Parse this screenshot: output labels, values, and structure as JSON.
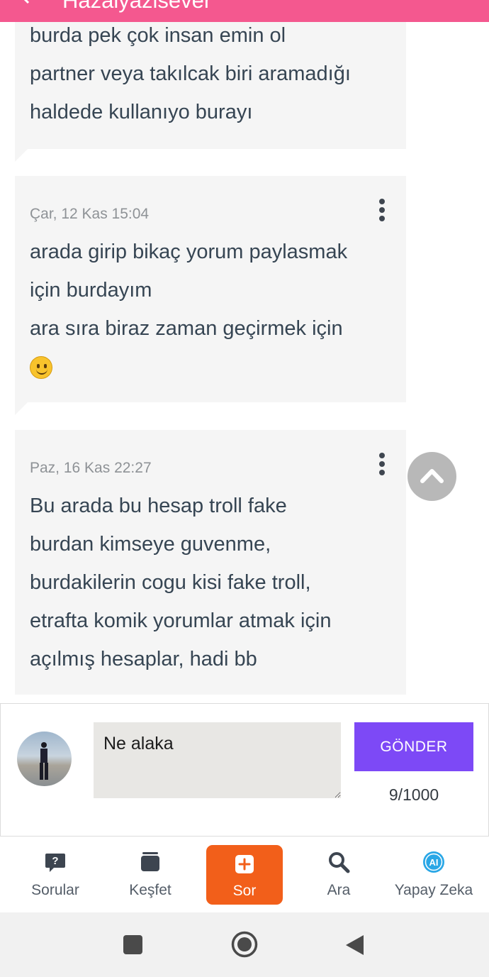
{
  "app_bar": {
    "title": "Hazalyazisever"
  },
  "messages": [
    {
      "date": "",
      "lines": [
        "burda pek çok insan emin ol",
        "partner veya takılcak biri aramadığı",
        "haldede kullanıyo burayı"
      ]
    },
    {
      "date": "Çar, 12 Kas 15:04",
      "lines": [
        "arada girip bikaç yorum paylasmak",
        "için burdayım",
        "ara sıra biraz zaman geçirmek için"
      ],
      "emoji": "slightly-smiling-face"
    },
    {
      "date": "Paz, 16 Kas 22:27",
      "lines": [
        "Bu arada bu hesap troll fake",
        "burdan kimseye guvenme,",
        "burdakilerin cogu kisi fake troll,",
        "etrafta komik yorumlar atmak için",
        "açılmış hesaplar, hadi bb"
      ]
    }
  ],
  "composer": {
    "value": "Ne alaka",
    "send_label": "GÖNDER",
    "counter": "9/1000"
  },
  "tabs": [
    {
      "label": "Sorular",
      "icon": "question-bubble-icon"
    },
    {
      "label": "Keşfet",
      "icon": "cards-stack-icon"
    },
    {
      "label": "Sor",
      "icon": "plus-square-icon",
      "active": true
    },
    {
      "label": "Ara",
      "icon": "magnifier-icon"
    },
    {
      "label": "Yapay Zeka",
      "icon": "ai-badge-icon"
    }
  ],
  "colors": {
    "app_bar": "#f4588f",
    "send_button": "#7d49f6",
    "active_tab": "#f25f1a",
    "ai_icon": "#2aa7e6"
  }
}
